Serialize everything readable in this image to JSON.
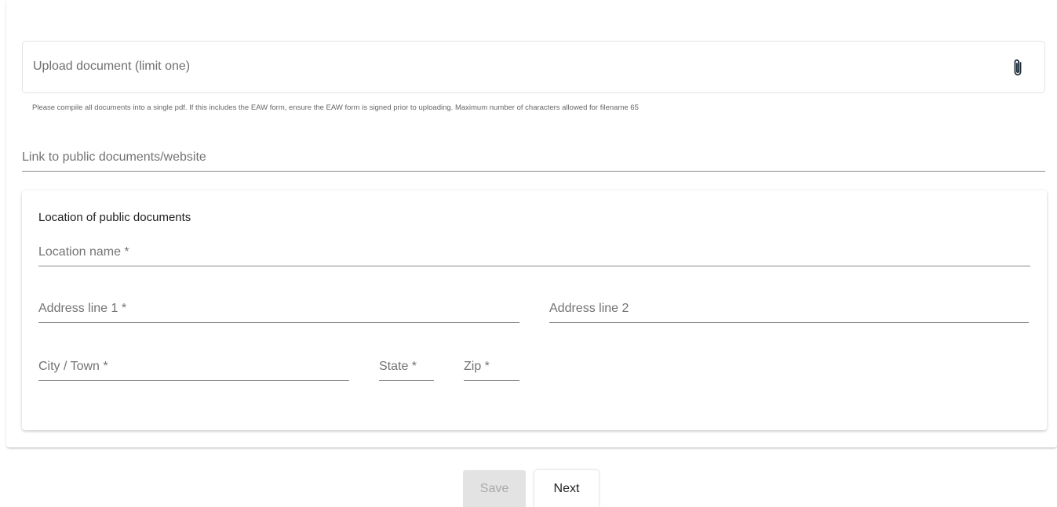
{
  "upload": {
    "label": "Upload document (limit one)",
    "icon": "paperclip-icon",
    "hint": "Please compile all documents into a single pdf. If this includes the EAW form, ensure the EAW form is signed prior to uploading. Maximum number of characters allowed for filename 65"
  },
  "link_field": {
    "placeholder": "Link to public documents/website"
  },
  "location": {
    "title": "Location of public documents",
    "name_placeholder": "Location name *",
    "address1_placeholder": "Address line 1 *",
    "address2_placeholder": "Address line 2",
    "city_placeholder": "City / Town *",
    "state_placeholder": "State *",
    "zip_placeholder": "Zip *"
  },
  "actions": {
    "save_label": "Save",
    "next_label": "Next"
  },
  "colors": {
    "save_disabled_bg": "#e3e3e3",
    "icon_color": "#1e2a38"
  }
}
